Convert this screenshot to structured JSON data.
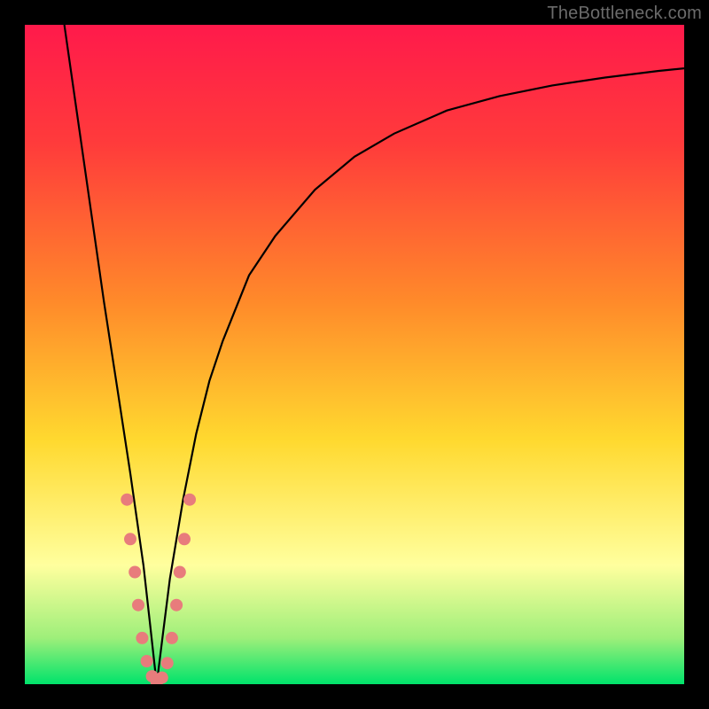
{
  "watermark": "TheBottleneck.com",
  "colors": {
    "top": "#ff1a4b",
    "red": "#ff3b3b",
    "orange": "#ff8a2a",
    "yellow": "#ffd92f",
    "pale_yellow": "#ffff9e",
    "pale_green": "#9eef7a",
    "green": "#00e36b",
    "curve": "#000000",
    "dot": "#e87c7c",
    "frame": "#000000"
  },
  "chart_data": {
    "type": "line",
    "title": "",
    "xlabel": "",
    "ylabel": "",
    "xlim": [
      0,
      100
    ],
    "ylim": [
      0,
      100
    ],
    "grid": false,
    "legend": false,
    "notch_x": 20,
    "series": [
      {
        "name": "bottleneck-curve",
        "x": [
          6,
          8,
          10,
          12,
          14,
          16,
          18,
          19,
          20,
          21,
          22,
          24,
          26,
          28,
          30,
          34,
          38,
          44,
          50,
          56,
          64,
          72,
          80,
          88,
          96,
          100
        ],
        "y": [
          100,
          86,
          72,
          58,
          45,
          32,
          18,
          9,
          0,
          8,
          16,
          28,
          38,
          46,
          52,
          62,
          68,
          75,
          80,
          83.5,
          87,
          89.2,
          90.8,
          92,
          93,
          93.4
        ]
      }
    ],
    "scatter": {
      "name": "highlight-dots",
      "points": [
        {
          "x": 15.5,
          "y": 28
        },
        {
          "x": 16.0,
          "y": 22
        },
        {
          "x": 16.7,
          "y": 17
        },
        {
          "x": 17.2,
          "y": 12
        },
        {
          "x": 17.8,
          "y": 7
        },
        {
          "x": 18.5,
          "y": 3.5
        },
        {
          "x": 19.3,
          "y": 1.2
        },
        {
          "x": 20.0,
          "y": 0.3
        },
        {
          "x": 20.8,
          "y": 1.0
        },
        {
          "x": 21.6,
          "y": 3.2
        },
        {
          "x": 22.3,
          "y": 7
        },
        {
          "x": 23.0,
          "y": 12
        },
        {
          "x": 23.5,
          "y": 17
        },
        {
          "x": 24.2,
          "y": 22
        },
        {
          "x": 25.0,
          "y": 28
        }
      ]
    }
  }
}
